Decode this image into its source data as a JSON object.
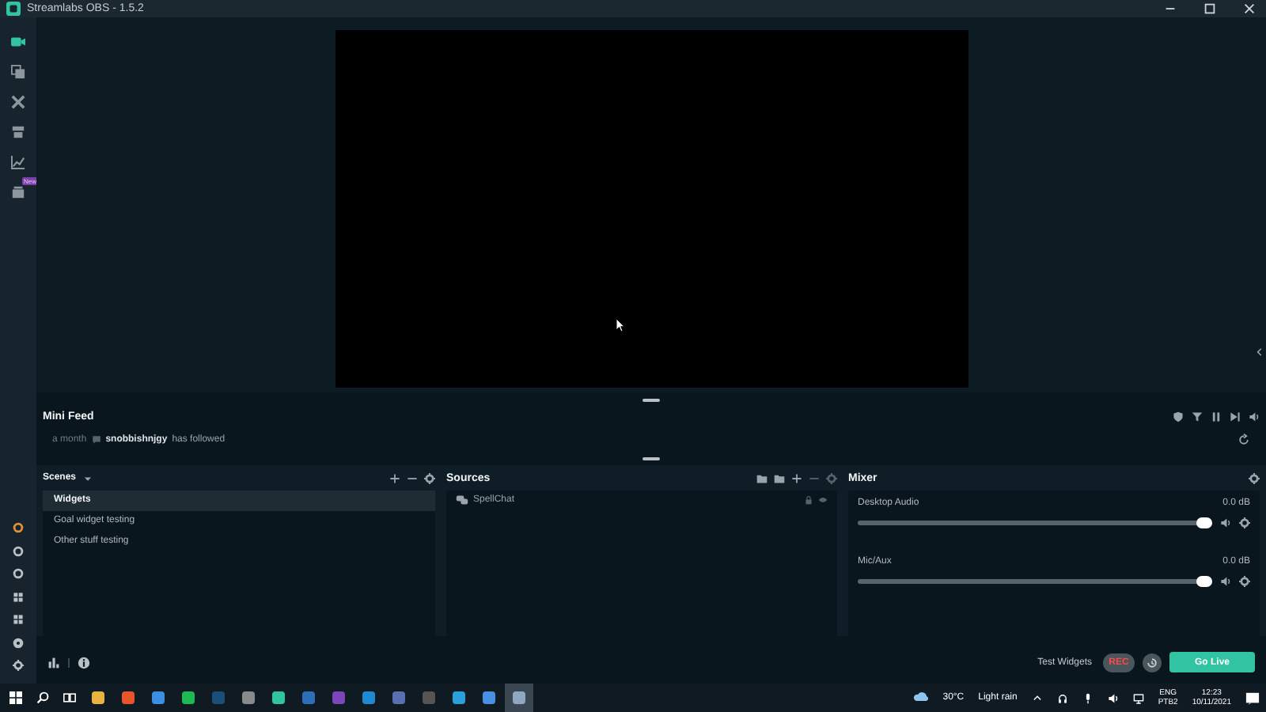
{
  "window": {
    "title": "Streamlabs OBS - 1.5.2"
  },
  "nav": {
    "items": [
      {
        "kind": "studio",
        "selected": true
      },
      {
        "kind": "themes",
        "selected": false
      },
      {
        "kind": "tools",
        "selected": false
      },
      {
        "kind": "store",
        "selected": false
      },
      {
        "kind": "stats",
        "selected": false
      },
      {
        "kind": "cloud",
        "selected": false,
        "badge": "New"
      }
    ],
    "bottom_items": [
      {
        "kind": "prime"
      },
      {
        "kind": "circle"
      },
      {
        "kind": "circle"
      },
      {
        "kind": "grid"
      },
      {
        "kind": "grid"
      },
      {
        "kind": "help"
      },
      {
        "kind": "settings"
      }
    ]
  },
  "mini_feed": {
    "title": "Mini Feed",
    "events": [
      {
        "time": "a month",
        "user": "snobbishnjgy",
        "action": "has followed"
      }
    ]
  },
  "scenes": {
    "title": "Scenes",
    "items": [
      {
        "label": "Widgets",
        "selected": true
      },
      {
        "label": "Goal widget testing",
        "selected": false
      },
      {
        "label": "Other stuff testing",
        "selected": false
      }
    ]
  },
  "sources": {
    "title": "Sources",
    "items": [
      {
        "label": "SpellChat"
      }
    ]
  },
  "mixer": {
    "title": "Mixer",
    "channels": [
      {
        "name": "Desktop Audio",
        "reading": "0.0 dB",
        "level": 1
      },
      {
        "name": "Mic/Aux",
        "reading": "0.0 dB",
        "level": 1
      }
    ]
  },
  "footer": {
    "test_widgets": "Test Widgets",
    "rec": "REC",
    "go_live": "Go Live"
  },
  "taskbar": {
    "apps": [
      {
        "color": "#e8b441",
        "selected": false
      },
      {
        "color": "#e8542c",
        "selected": false
      },
      {
        "color": "#3b8fe0",
        "selected": false
      },
      {
        "color": "#1db954",
        "selected": false
      },
      {
        "color": "#1b4f7a",
        "selected": false
      },
      {
        "color": "#8a8a8a",
        "selected": false
      },
      {
        "color": "#31c3a2",
        "selected": false
      },
      {
        "color": "#2c6fb8",
        "selected": false
      },
      {
        "color": "#7a46b8",
        "selected": false
      },
      {
        "color": "#1f8ad2",
        "selected": false
      },
      {
        "color": "#5a6fb0",
        "selected": false
      },
      {
        "color": "#555555",
        "selected": false
      },
      {
        "color": "#2a9fd8",
        "selected": false
      },
      {
        "color": "#4a90e2",
        "selected": false
      },
      {
        "color": "#8fa8c0",
        "selected": true
      }
    ],
    "temperature": "30°C",
    "weather": "Light rain",
    "language": "ENG",
    "layout": "PTB2",
    "time": "12:23",
    "date": "10/11/2021"
  }
}
